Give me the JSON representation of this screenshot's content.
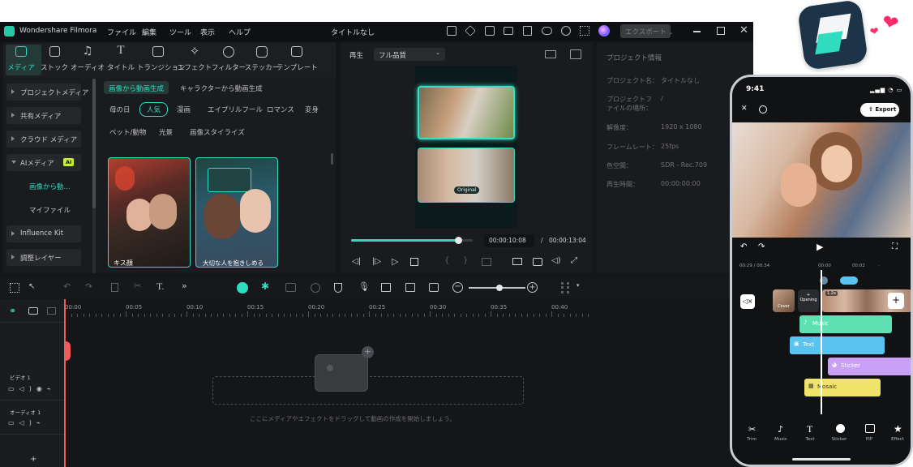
{
  "app": {
    "name": "Wondershare Filmora",
    "project_title": "タイトルなし",
    "menu": [
      "ファイル",
      "編集",
      "ツール",
      "表示",
      "ヘルプ"
    ],
    "export_label": "エクスポート"
  },
  "toolbar": {
    "tabs": [
      {
        "label": "メディア",
        "icon": "media-icon",
        "active": true
      },
      {
        "label": "ストック",
        "icon": "stock-icon"
      },
      {
        "label": "オーディオ",
        "icon": "music-note-icon"
      },
      {
        "label": "タイトル",
        "icon": "title-t-icon"
      },
      {
        "label": "トランジション",
        "icon": "transition-icon"
      },
      {
        "label": "エフェクト",
        "icon": "effects-sparkle-icon"
      },
      {
        "label": "フィルター",
        "icon": "filter-icon"
      },
      {
        "label": "ステッカー",
        "icon": "sticker-icon"
      },
      {
        "label": "テンプレート",
        "icon": "template-icon"
      }
    ]
  },
  "sidebar": {
    "items": [
      {
        "label": "プロジェクトメディア"
      },
      {
        "label": "共有メディア"
      },
      {
        "label": "クラウド メディア"
      },
      {
        "label": "AIメディア",
        "badge": "AI"
      },
      {
        "label": "画像から動..."
      },
      {
        "label": "マイファイル"
      },
      {
        "label": "Influence Kit"
      },
      {
        "label": "調整レイヤー"
      }
    ]
  },
  "media": {
    "tabs": [
      "画像から動画生成",
      "キャラクターから動画生成"
    ],
    "categories_row1": [
      "母の日",
      "人気",
      "漫画",
      "エイプリルフール",
      "ロマンス",
      "変身"
    ],
    "categories_row2": [
      "ペット/動物",
      "光景",
      "画像スタイライズ"
    ],
    "thumbs": [
      "キス顔",
      "大切な人を抱きしめる"
    ]
  },
  "player": {
    "label": "再生",
    "quality": "フル品質",
    "original_tag": "Original",
    "current_time": "00:00:10:08",
    "total_time": "00:00:13:04",
    "progress": 0.88
  },
  "project_info": {
    "title": "プロジェクト情報",
    "rows": [
      {
        "label": "プロジェクト名：",
        "value": "タイトルなし"
      },
      {
        "label": "プロジェクトファイルの場所：",
        "value": "/"
      },
      {
        "label": "解像度：",
        "value": "1920 x 1080"
      },
      {
        "label": "フレームレート：",
        "value": "25fps"
      },
      {
        "label": "色空間：",
        "value": "SDR - Rec.709"
      },
      {
        "label": "再生時間：",
        "value": "00:00:00:00"
      }
    ]
  },
  "timeline": {
    "ruler": [
      "00:00",
      "00:05",
      "00:10",
      "00:15",
      "00:20",
      "00:25",
      "00:30",
      "00:35",
      "00:40"
    ],
    "tracks": [
      {
        "label": "ビデオ 1"
      },
      {
        "label": "オーディオ 1"
      }
    ],
    "drop_hint": "ここにメディアやエフェクトをドラッグして動画の作成を開始しましょう。"
  },
  "phone": {
    "time": "9:41",
    "export_label": "Export",
    "time_current": "00:29",
    "time_total": "00:34",
    "ruler": [
      "00:00",
      "00:02"
    ],
    "cover_label": "Cover",
    "opening_label": "Opening",
    "speed_badge": "1.2x",
    "clips": [
      {
        "label": "Music",
        "color": "#5fe0b3"
      },
      {
        "label": "Text",
        "color": "#5bc3f0"
      },
      {
        "label": "Sticker",
        "color": "#c9a0f5"
      },
      {
        "label": "Mosaic",
        "color": "#f0e36a"
      }
    ],
    "tools": [
      "Trim",
      "Music",
      "Text",
      "Sticker",
      "PIP",
      "Effect"
    ]
  },
  "colors": {
    "accent": "#2fdcc0",
    "bg": "#151619",
    "panel": "#1e1f23",
    "playhead": "#ef5a5a",
    "logo_bg": "#1d3448",
    "heart": "#ff2a6a"
  }
}
